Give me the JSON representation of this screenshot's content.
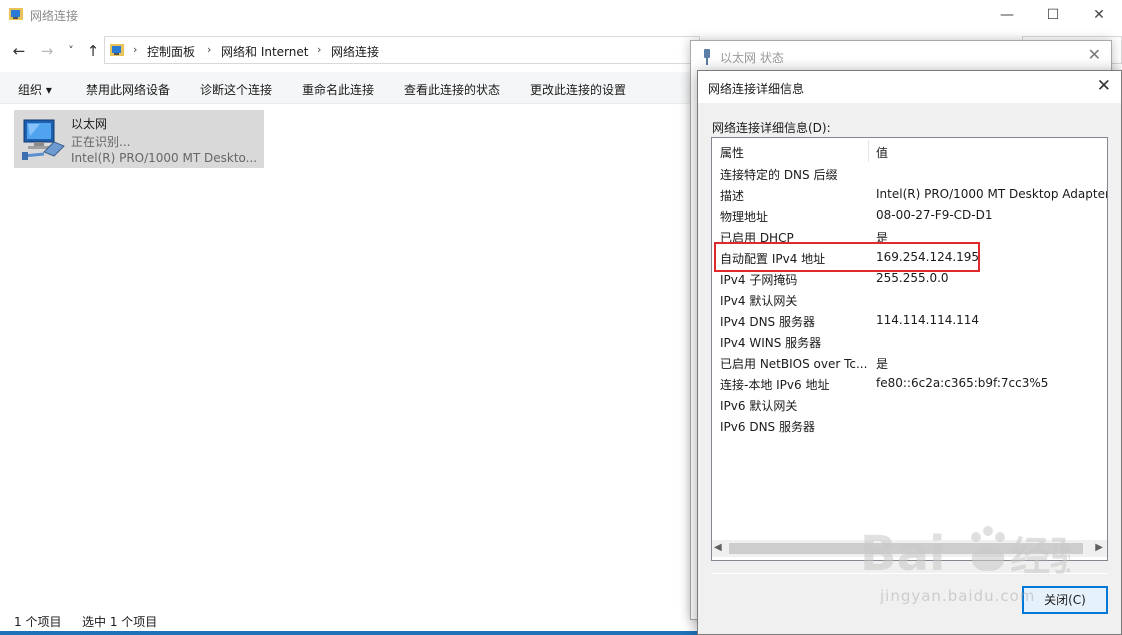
{
  "window": {
    "title": "网络连接",
    "minimize": "—",
    "maximize": "☐",
    "close": "✕"
  },
  "nav": {
    "back": "←",
    "forward": "→",
    "recent": "˅",
    "up": "↑"
  },
  "breadcrumb": [
    "控制面板",
    "网络和 Internet",
    "网络连接"
  ],
  "toolbar": {
    "organize": "组织 ▾",
    "disable": "禁用此网络设备",
    "diagnose": "诊断这个连接",
    "rename": "重命名此连接",
    "view_status": "查看此连接的状态",
    "change_settings": "更改此连接的设置"
  },
  "connection": {
    "name": "以太网",
    "status": "正在识别...",
    "adapter": "Intel(R) PRO/1000 MT Deskto..."
  },
  "statusbar": {
    "count": "1 个项目",
    "selected": "选中 1 个项目"
  },
  "status_window": {
    "title": "以太网 状态"
  },
  "details_dialog": {
    "title": "网络连接详细信息",
    "label": "网络连接详细信息(D):",
    "col_property": "属性",
    "col_value": "值",
    "rows": [
      {
        "property": "连接特定的 DNS 后缀",
        "value": ""
      },
      {
        "property": "描述",
        "value": "Intel(R) PRO/1000 MT Desktop Adapter"
      },
      {
        "property": "物理地址",
        "value": "08-00-27-F9-CD-D1"
      },
      {
        "property": "已启用 DHCP",
        "value": "是"
      },
      {
        "property": "自动配置 IPv4 地址",
        "value": "169.254.124.195"
      },
      {
        "property": "IPv4 子网掩码",
        "value": "255.255.0.0"
      },
      {
        "property": "IPv4 默认网关",
        "value": ""
      },
      {
        "property": "IPv4 DNS 服务器",
        "value": "114.114.114.114"
      },
      {
        "property": "IPv4 WINS 服务器",
        "value": ""
      },
      {
        "property": "已启用 NetBIOS over Tc...",
        "value": "是"
      },
      {
        "property": "连接-本地 IPv6 地址",
        "value": "fe80::6c2a:c365:b9f:7cc3%5"
      },
      {
        "property": "IPv6 默认网关",
        "value": ""
      },
      {
        "property": "IPv6 DNS 服务器",
        "value": ""
      }
    ],
    "close_button": "关闭(C)"
  },
  "watermark": {
    "text": "jingyan.baidu.com"
  },
  "colors": {
    "highlight": "#e0282d",
    "accent": "#0078d7"
  }
}
